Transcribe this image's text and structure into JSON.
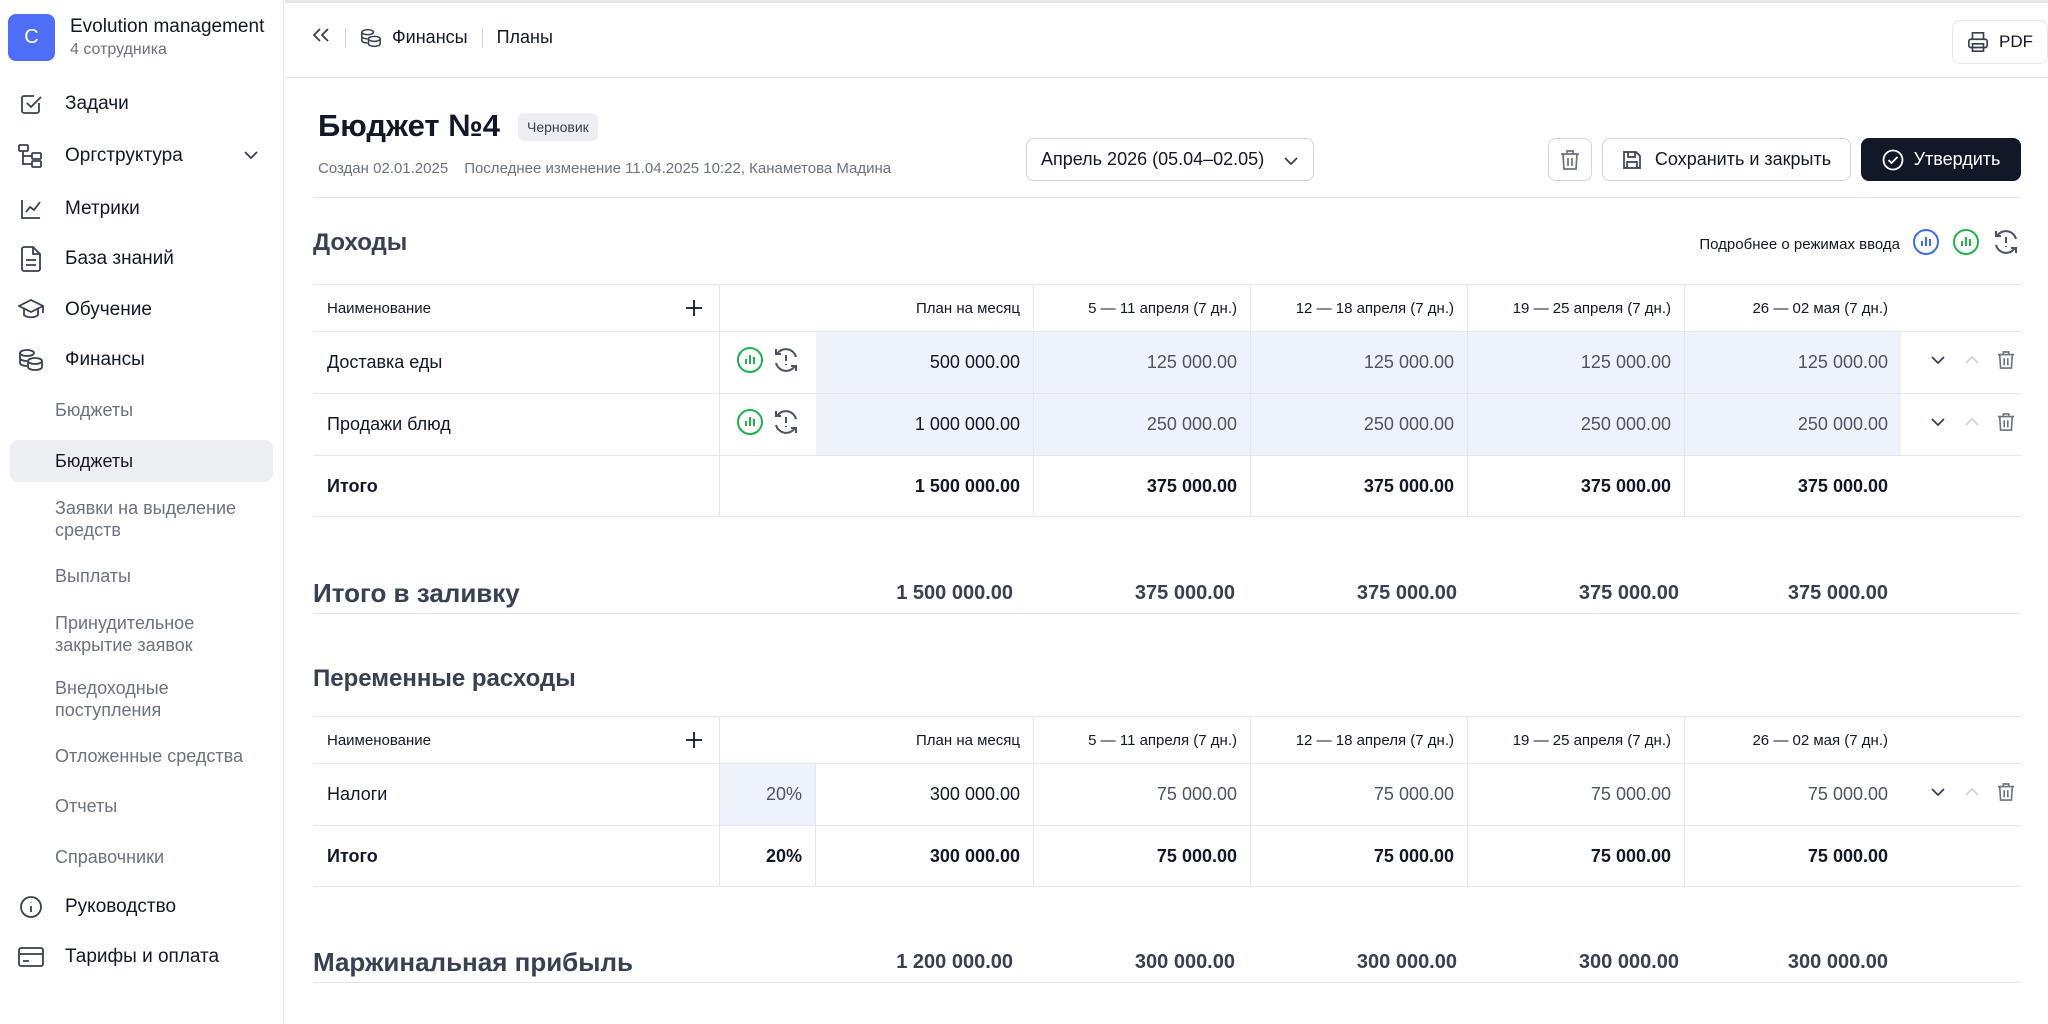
{
  "org": {
    "initial": "C",
    "name": "Evolution management",
    "sub": "4 сотрудника"
  },
  "nav": {
    "tasks": "Задачи",
    "orgstructure": "Оргструктура",
    "metrics": "Метрики",
    "knowledge": "База знаний",
    "learning": "Обучение",
    "finance": "Финансы",
    "sub": [
      "Бюджеты",
      "Бюджеты",
      "Заявки на выделение средств",
      "Выплаты",
      "Принудительное закрытие заявок",
      "Внедоходные поступления",
      "Отложенные средства",
      "Отчеты",
      "Справочники"
    ],
    "guide": "Руководство",
    "tariffs": "Тарифы и оплата"
  },
  "breadcrumb": {
    "section": "Финансы",
    "page": "Планы"
  },
  "pdf_label": "PDF",
  "budget": {
    "title": "Бюджет №4",
    "status": "Черновик",
    "created": "Создан 02.01.2025",
    "modified": "Последнее изменение 11.04.2025 10:22, Канаметова Мадина",
    "period": "Апрель 2026 (05.04–02.05)",
    "save_label": "Сохранить и закрыть",
    "approve_label": "Утвердить"
  },
  "columns": {
    "name": "Наименование",
    "plan": "План на месяц",
    "weeks": [
      "5 — 11 апреля (7 дн.)",
      "12 — 18 апреля (7 дн.)",
      "19 — 25 апреля (7 дн.)",
      "26 — 02 мая (7 дн.)"
    ]
  },
  "income": {
    "title": "Доходы",
    "modes_text": "Подробнее о режимах ввода",
    "rows": [
      {
        "name": "Доставка еды",
        "plan": "500 000.00",
        "weeks": [
          "125 000.00",
          "125 000.00",
          "125 000.00",
          "125 000.00"
        ]
      },
      {
        "name": "Продажи блюд",
        "plan": "1 000 000.00",
        "weeks": [
          "250 000.00",
          "250 000.00",
          "250 000.00",
          "250 000.00"
        ]
      }
    ],
    "total": {
      "label": "Итого",
      "plan": "1 500 000.00",
      "weeks": [
        "375 000.00",
        "375 000.00",
        "375 000.00",
        "375 000.00"
      ]
    }
  },
  "fill_total": {
    "label": "Итого в заливку",
    "plan": "1 500 000.00",
    "weeks": [
      "375 000.00",
      "375 000.00",
      "375 000.00",
      "375 000.00"
    ]
  },
  "variable": {
    "title": "Переменные расходы",
    "rows": [
      {
        "name": "Налоги",
        "pct": "20%",
        "plan": "300 000.00",
        "weeks": [
          "75 000.00",
          "75 000.00",
          "75 000.00",
          "75 000.00"
        ]
      }
    ],
    "total": {
      "label": "Итого",
      "pct": "20%",
      "plan": "300 000.00",
      "weeks": [
        "75 000.00",
        "75 000.00",
        "75 000.00",
        "75 000.00"
      ]
    }
  },
  "margin": {
    "label": "Маржинальная прибыль",
    "plan": "1 200 000.00",
    "weeks": [
      "300 000.00",
      "300 000.00",
      "300 000.00",
      "300 000.00"
    ]
  },
  "colors": {
    "accent": "#4f6ef7",
    "dark": "#111827",
    "highlight": "#eef2fb",
    "mode_blue": "#3b6fe0",
    "mode_green": "#22b14c"
  }
}
